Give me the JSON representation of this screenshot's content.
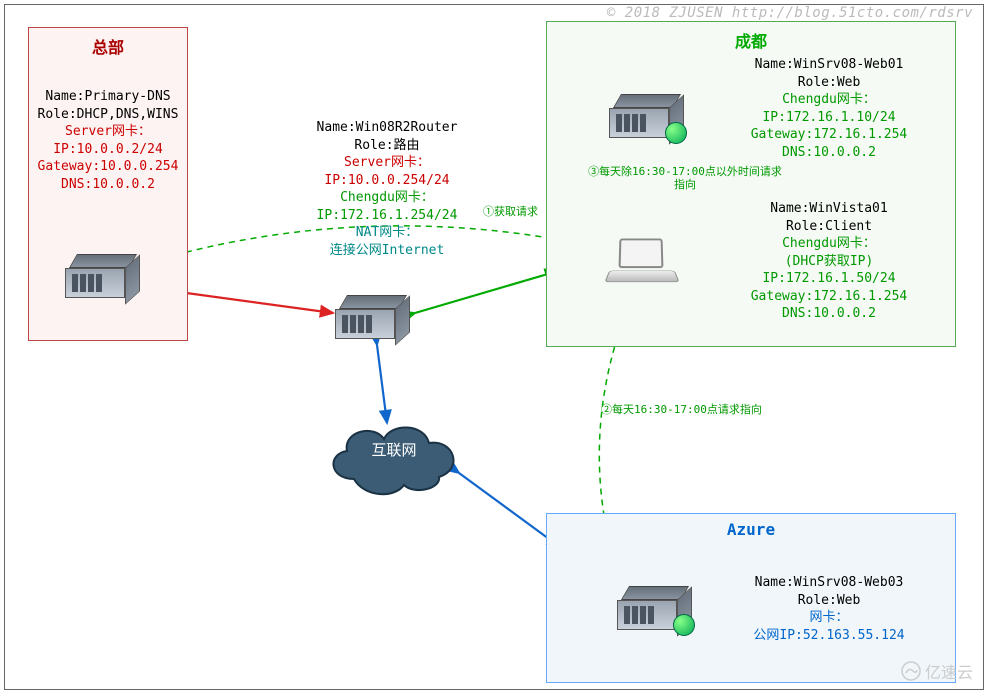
{
  "watermark": {
    "top": "© 2018 ZJUSEN http://blog.51cto.com/rdsrv",
    "logo": "亿速云"
  },
  "boxes": {
    "hq": {
      "title": "总部"
    },
    "cd": {
      "title": "成都"
    },
    "az": {
      "title": "Azure"
    }
  },
  "nodes": {
    "primaryDns": {
      "name": "Name:Primary-DNS",
      "role": "Role:DHCP,DNS,WINS",
      "nicLabel": "Server网卡：",
      "ip": "IP:10.0.0.2/24",
      "gw": "Gateway:10.0.0.254",
      "dns": "DNS:10.0.0.2"
    },
    "router": {
      "name": "Name:Win08R2Router",
      "role": "Role:路由",
      "nic1Label": "Server网卡：",
      "nic1Ip": "IP:10.0.0.254/24",
      "nic2Label": "Chengdu网卡：",
      "nic2Ip": "IP:172.16.1.254/24",
      "nic3Label": "NAT网卡：",
      "nic3Ip": "连接公网Internet"
    },
    "web01": {
      "name": "Name:WinSrv08-Web01",
      "role": "Role:Web",
      "nicLabel": "Chengdu网卡：",
      "ip": "IP:172.16.1.10/24",
      "gw": "Gateway:172.16.1.254",
      "dns": "DNS:10.0.0.2"
    },
    "vista": {
      "name": "Name:WinVista01",
      "role": "Role:Client",
      "nicLabel": "Chengdu网卡：",
      "dhcp": "(DHCP获取IP)",
      "ip": "IP:172.16.1.50/24",
      "gw": "Gateway:172.16.1.254",
      "dns": "DNS:10.0.0.2"
    },
    "web03": {
      "name": "Name:WinSrv08-Web03",
      "role": "Role:Web",
      "nicLabel": "网卡：",
      "ip": "公网IP:52.163.55.124"
    }
  },
  "cloud": {
    "label": "互联网"
  },
  "annotations": {
    "req1": "①获取请求",
    "req2": "②每天16:30-17:00点请求指向",
    "req3": "③每天除16:30-17:00点以外时间请求指向"
  }
}
